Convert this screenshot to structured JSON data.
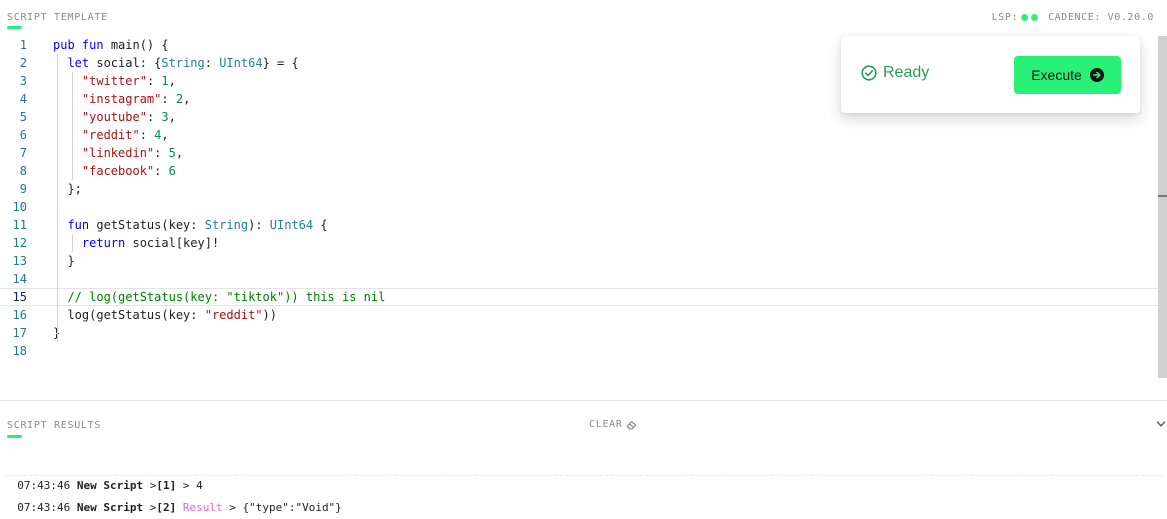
{
  "header": {
    "title": "SCRIPT TEMPLATE",
    "lsp_label": "LSP:",
    "cadence_version": "CADENCE: V0.20.0"
  },
  "colors": {
    "accent": "#2bf078",
    "ready": "#2a9d55",
    "result_label": "#e26ad8"
  },
  "editor": {
    "active_line": 15,
    "lines": [
      {
        "number": "1",
        "tokens": [
          [
            "kw",
            "pub "
          ],
          [
            "kw",
            "fun "
          ],
          [
            "p",
            "main() {"
          ]
        ]
      },
      {
        "number": "2",
        "tokens": [
          [
            "p",
            "  "
          ],
          [
            "kw",
            "let "
          ],
          [
            "p",
            "social: {"
          ],
          [
            "ty",
            "String"
          ],
          [
            "p",
            ": "
          ],
          [
            "ty",
            "UInt64"
          ],
          [
            "p",
            "} = {"
          ]
        ]
      },
      {
        "number": "3",
        "tokens": [
          [
            "p",
            "    "
          ],
          [
            "str",
            "\"twitter\""
          ],
          [
            "p",
            ": "
          ],
          [
            "num",
            "1"
          ],
          [
            "p",
            ","
          ]
        ]
      },
      {
        "number": "4",
        "tokens": [
          [
            "p",
            "    "
          ],
          [
            "str",
            "\"instagram\""
          ],
          [
            "p",
            ": "
          ],
          [
            "num",
            "2"
          ],
          [
            "p",
            ","
          ]
        ]
      },
      {
        "number": "5",
        "tokens": [
          [
            "p",
            "    "
          ],
          [
            "str",
            "\"youtube\""
          ],
          [
            "p",
            ": "
          ],
          [
            "num",
            "3"
          ],
          [
            "p",
            ","
          ]
        ]
      },
      {
        "number": "6",
        "tokens": [
          [
            "p",
            "    "
          ],
          [
            "str",
            "\"reddit\""
          ],
          [
            "p",
            ": "
          ],
          [
            "num",
            "4"
          ],
          [
            "p",
            ","
          ]
        ]
      },
      {
        "number": "7",
        "tokens": [
          [
            "p",
            "    "
          ],
          [
            "str",
            "\"linkedin\""
          ],
          [
            "p",
            ": "
          ],
          [
            "num",
            "5"
          ],
          [
            "p",
            ","
          ]
        ]
      },
      {
        "number": "8",
        "tokens": [
          [
            "p",
            "    "
          ],
          [
            "str",
            "\"facebook\""
          ],
          [
            "p",
            ": "
          ],
          [
            "num",
            "6"
          ]
        ]
      },
      {
        "number": "9",
        "tokens": [
          [
            "p",
            "  };"
          ]
        ]
      },
      {
        "number": "10",
        "tokens": []
      },
      {
        "number": "11",
        "tokens": [
          [
            "p",
            "  "
          ],
          [
            "kw",
            "fun "
          ],
          [
            "p",
            "getStatus(key: "
          ],
          [
            "ty",
            "String"
          ],
          [
            "p",
            "): "
          ],
          [
            "ty",
            "UInt64"
          ],
          [
            "p",
            " {"
          ]
        ]
      },
      {
        "number": "12",
        "tokens": [
          [
            "p",
            "    "
          ],
          [
            "kw",
            "return "
          ],
          [
            "p",
            "social[key]!"
          ]
        ]
      },
      {
        "number": "13",
        "tokens": [
          [
            "p",
            "  }"
          ]
        ]
      },
      {
        "number": "14",
        "tokens": []
      },
      {
        "number": "15",
        "tokens": [
          [
            "p",
            "  "
          ],
          [
            "com",
            "// log(getStatus(key: \"tiktok\")) this is nil"
          ]
        ]
      },
      {
        "number": "16",
        "tokens": [
          [
            "p",
            "  log(getStatus(key: "
          ],
          [
            "str",
            "\"reddit\""
          ],
          [
            "p",
            "))"
          ]
        ]
      },
      {
        "number": "17",
        "tokens": [
          [
            "p",
            "}"
          ]
        ]
      },
      {
        "number": "18",
        "tokens": []
      }
    ]
  },
  "status": {
    "ready_label": "Ready",
    "execute_label": "Execute"
  },
  "results": {
    "title": "SCRIPT RESULTS",
    "clear_label": "CLEAR",
    "rows": [
      {
        "time": "07:43:46",
        "name": "New Script",
        "index": "[1]",
        "label": "",
        "value": "4"
      },
      {
        "time": "07:43:46",
        "name": "New Script",
        "index": "[2]",
        "label": "Result",
        "value": "{\"type\":\"Void\"}"
      }
    ]
  }
}
